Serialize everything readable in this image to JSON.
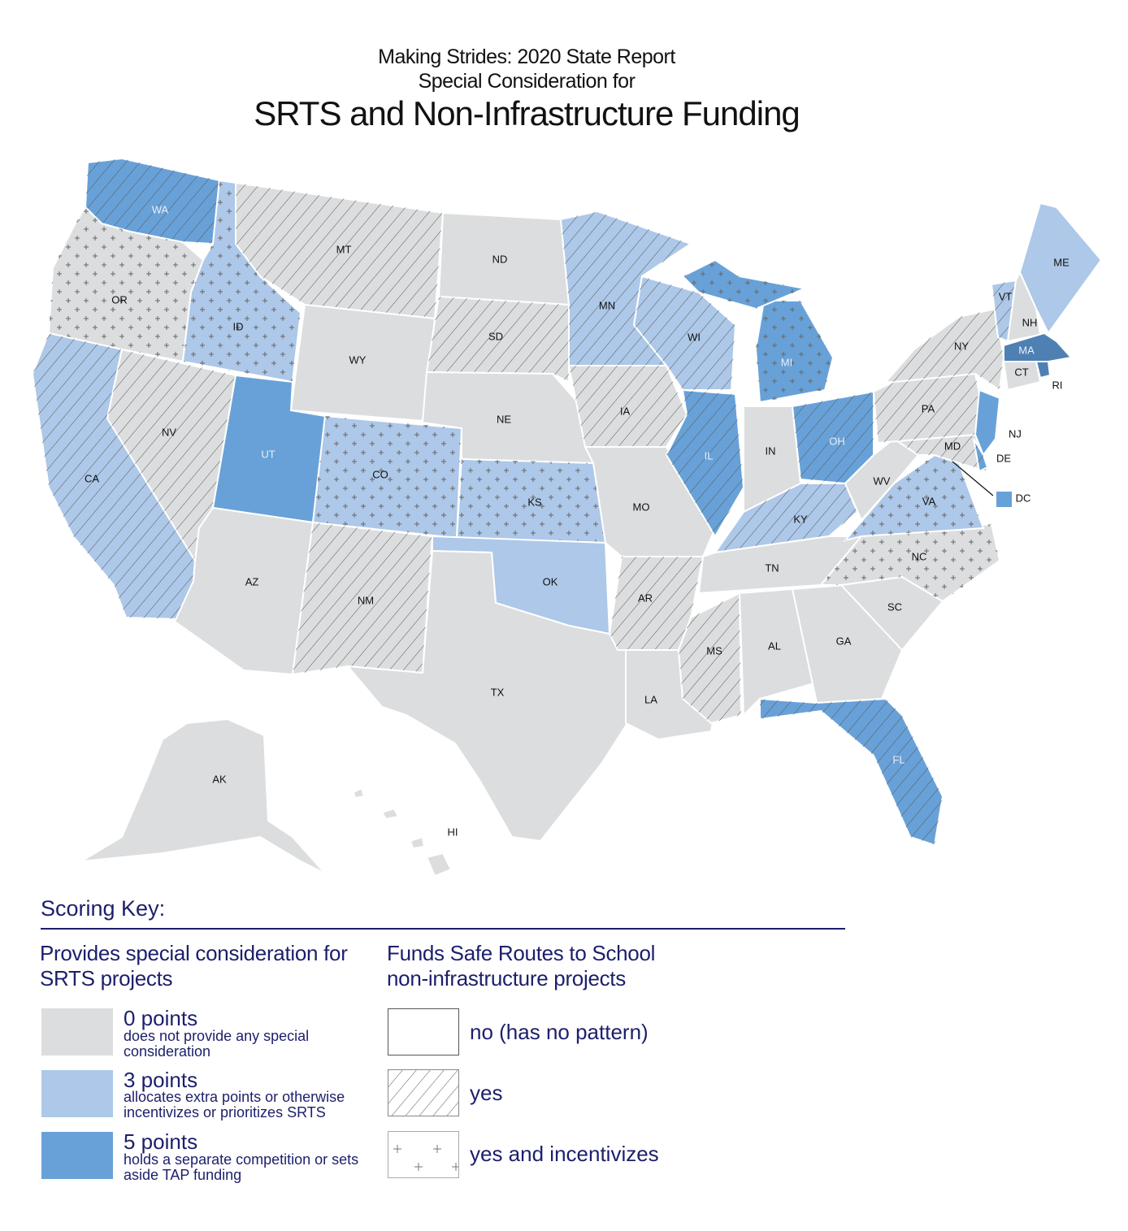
{
  "title": {
    "line1": "Making Strides:  2020 State Report",
    "line2": "Special Consideration for",
    "line3": "SRTS and Non-Infrastructure Funding"
  },
  "colors": {
    "0": "#dcddde",
    "3": "#adc8e8",
    "5": "#68a1d7",
    "5_dark": "#4f80b3",
    "border": "#ffffff",
    "text": "#1c1f6b"
  },
  "states": [
    {
      "code": "WA",
      "score": 5,
      "funding": "yes"
    },
    {
      "code": "OR",
      "score": 0,
      "funding": "yes and incentivizes"
    },
    {
      "code": "CA",
      "score": 3,
      "funding": "yes"
    },
    {
      "code": "ID",
      "score": 3,
      "funding": "yes and incentivizes"
    },
    {
      "code": "NV",
      "score": 0,
      "funding": "yes"
    },
    {
      "code": "MT",
      "score": 0,
      "funding": "yes"
    },
    {
      "code": "WY",
      "score": 0,
      "funding": "no"
    },
    {
      "code": "UT",
      "score": 5,
      "funding": "no"
    },
    {
      "code": "AZ",
      "score": 0,
      "funding": "no"
    },
    {
      "code": "CO",
      "score": 3,
      "funding": "yes and incentivizes"
    },
    {
      "code": "NM",
      "score": 0,
      "funding": "yes"
    },
    {
      "code": "ND",
      "score": 0,
      "funding": "no"
    },
    {
      "code": "SD",
      "score": 0,
      "funding": "yes"
    },
    {
      "code": "NE",
      "score": 0,
      "funding": "no"
    },
    {
      "code": "KS",
      "score": 3,
      "funding": "yes and incentivizes"
    },
    {
      "code": "OK",
      "score": 3,
      "funding": "no"
    },
    {
      "code": "TX",
      "score": 0,
      "funding": "no"
    },
    {
      "code": "MN",
      "score": 3,
      "funding": "yes"
    },
    {
      "code": "IA",
      "score": 0,
      "funding": "yes"
    },
    {
      "code": "MO",
      "score": 0,
      "funding": "no"
    },
    {
      "code": "AR",
      "score": 0,
      "funding": "yes"
    },
    {
      "code": "LA",
      "score": 0,
      "funding": "no"
    },
    {
      "code": "WI",
      "score": 3,
      "funding": "yes"
    },
    {
      "code": "IL",
      "score": 5,
      "funding": "yes"
    },
    {
      "code": "MI",
      "score": 5,
      "funding": "yes and incentivizes"
    },
    {
      "code": "IN",
      "score": 0,
      "funding": "no"
    },
    {
      "code": "OH",
      "score": 5,
      "funding": "yes"
    },
    {
      "code": "KY",
      "score": 3,
      "funding": "yes"
    },
    {
      "code": "TN",
      "score": 0,
      "funding": "no"
    },
    {
      "code": "MS",
      "score": 0,
      "funding": "yes"
    },
    {
      "code": "AL",
      "score": 0,
      "funding": "no"
    },
    {
      "code": "GA",
      "score": 0,
      "funding": "no"
    },
    {
      "code": "FL",
      "score": 5,
      "funding": "yes"
    },
    {
      "code": "SC",
      "score": 0,
      "funding": "no"
    },
    {
      "code": "NC",
      "score": 0,
      "funding": "yes and incentivizes"
    },
    {
      "code": "VA",
      "score": 3,
      "funding": "yes and incentivizes"
    },
    {
      "code": "WV",
      "score": 0,
      "funding": "no"
    },
    {
      "code": "MD",
      "score": 0,
      "funding": "yes"
    },
    {
      "code": "PA",
      "score": 0,
      "funding": "yes"
    },
    {
      "code": "NY",
      "score": 0,
      "funding": "yes"
    },
    {
      "code": "NJ",
      "score": 5,
      "funding": "no"
    },
    {
      "code": "DE",
      "score": 5,
      "funding": "yes"
    },
    {
      "code": "VT",
      "score": 3,
      "funding": "yes"
    },
    {
      "code": "NH",
      "score": 0,
      "funding": "no"
    },
    {
      "code": "ME",
      "score": 3,
      "funding": "no"
    },
    {
      "code": "MA",
      "score": 5,
      "funding": "no"
    },
    {
      "code": "CT",
      "score": 0,
      "funding": "no"
    },
    {
      "code": "RI",
      "score": 5,
      "funding": "no"
    },
    {
      "code": "DC",
      "score": 5,
      "funding": "no"
    },
    {
      "code": "AK",
      "score": 0,
      "funding": "no"
    },
    {
      "code": "HI",
      "score": 0,
      "funding": "no"
    }
  ],
  "key": {
    "title": "Scoring Key:",
    "score_heading": "Provides special consideration for SRTS projects",
    "funding_heading": "Funds Safe Routes to School non-infrastructure projects",
    "scores": [
      {
        "points": "0 points",
        "desc": "does not provide any special consideration"
      },
      {
        "points": "3 points",
        "desc": "allocates extra points or otherwise incentivizes or prioritizes SRTS"
      },
      {
        "points": "5 points",
        "desc": "holds a separate competition or sets aside TAP funding"
      }
    ],
    "patterns": [
      {
        "label": "no (has no pattern)"
      },
      {
        "label": "yes"
      },
      {
        "label": "yes and incentivizes"
      }
    ]
  }
}
